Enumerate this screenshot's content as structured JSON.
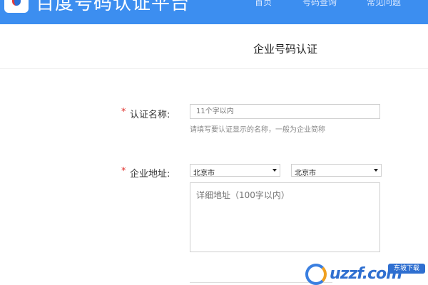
{
  "header": {
    "brand": "百度号码认证平台",
    "nav": [
      {
        "label": "首页"
      },
      {
        "label": "号码查询"
      },
      {
        "label": "常见问题"
      }
    ]
  },
  "page": {
    "title": "企业号码认证"
  },
  "form": {
    "name": {
      "required": "*",
      "label": "认证名称:",
      "placeholder": "11个字以内",
      "hint": "请填写要认证显示的名称，一般为企业简称"
    },
    "address": {
      "required": "*",
      "label": "企业地址:",
      "province": "北京市",
      "city": "北京市",
      "detail_placeholder": "详细地址（100字以内）"
    }
  },
  "watermark": {
    "text": "uzzf.com",
    "badge": "东坡下载"
  },
  "colors": {
    "header_bg": "#3c8ef0",
    "required": "#e0312c"
  }
}
